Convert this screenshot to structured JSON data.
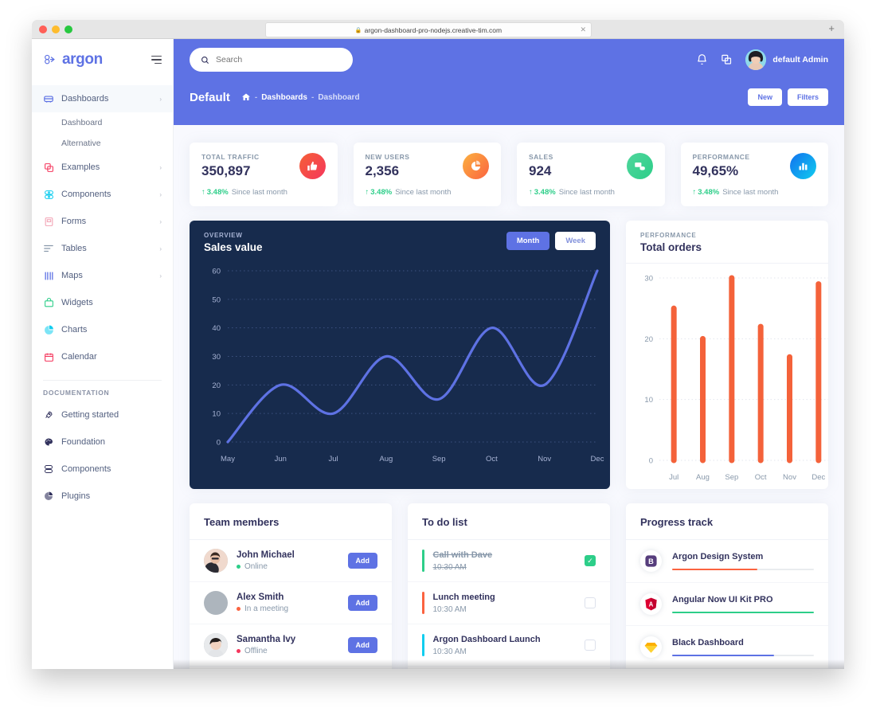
{
  "browser": {
    "url": "argon-dashboard-pro-nodejs.creative-tim.com",
    "lock_icon": "lock-icon",
    "close_tab_icon": "close-icon",
    "new_tab_icon": "plus-icon"
  },
  "sidebar": {
    "brand": "argon",
    "brand_color": "#5e72e4",
    "toggle_icon": "hamburger-icon",
    "items": [
      {
        "label": "Dashboards",
        "icon": "dashboard-icon",
        "color": "#5e72e4",
        "active": true,
        "chevron": "›"
      },
      {
        "label": "Examples",
        "icon": "examples-icon",
        "color": "#f5365c",
        "active": false,
        "chevron": "›"
      },
      {
        "label": "Components",
        "icon": "components-icon",
        "color": "#11cdef",
        "active": false,
        "chevron": "›"
      },
      {
        "label": "Forms",
        "icon": "forms-icon",
        "color": "#f3a4b5",
        "active": false,
        "chevron": "›"
      },
      {
        "label": "Tables",
        "icon": "tables-icon",
        "color": "#8898aa",
        "active": false,
        "chevron": "›"
      },
      {
        "label": "Maps",
        "icon": "maps-icon",
        "color": "#5e72e4",
        "active": false,
        "chevron": "›"
      },
      {
        "label": "Widgets",
        "icon": "widgets-icon",
        "color": "#2dce89",
        "active": false,
        "chevron": ""
      },
      {
        "label": "Charts",
        "icon": "charts-icon",
        "color": "#11cdef",
        "active": false,
        "chevron": ""
      },
      {
        "label": "Calendar",
        "icon": "calendar-icon",
        "color": "#f5365c",
        "active": false,
        "chevron": ""
      }
    ],
    "sub_items": [
      {
        "label": "Dashboard"
      },
      {
        "label": "Alternative"
      }
    ],
    "doc_section": "DOCUMENTATION",
    "doc_items": [
      {
        "label": "Getting started",
        "icon": "rocket-icon",
        "color": "#32325d"
      },
      {
        "label": "Foundation",
        "icon": "palette-icon",
        "color": "#32325d"
      },
      {
        "label": "Components",
        "icon": "components-icon",
        "color": "#32325d"
      },
      {
        "label": "Plugins",
        "icon": "pie-icon",
        "color": "#32325d"
      }
    ]
  },
  "topbar": {
    "bg_color": "#5e72e4",
    "search": {
      "placeholder": "Search",
      "value": "",
      "icon": "search-icon"
    },
    "bell_icon": "bell-icon",
    "apps_icon": "layers-icon",
    "avatar": "user-avatar",
    "user_name": "default Admin"
  },
  "header": {
    "title": "Default",
    "home_icon": "home-icon",
    "breadcrumb": [
      {
        "label": "Dashboards",
        "current": false
      },
      {
        "label": "Dashboard",
        "current": true
      }
    ],
    "separator": "-",
    "buttons": [
      {
        "label": "New"
      },
      {
        "label": "Filters"
      }
    ]
  },
  "stats": [
    {
      "label": "TOTAL TRAFFIC",
      "value": "350,897",
      "delta": "3.48%",
      "delta_arrow": "↑",
      "delta_color": "#2dce89",
      "caption": "Since last month",
      "icon": "thumbs-up-icon",
      "icon_bg": "#f5365c"
    },
    {
      "label": "NEW USERS",
      "value": "2,356",
      "delta": "3.48%",
      "delta_arrow": "↑",
      "delta_color": "#2dce89",
      "caption": "Since last month",
      "icon": "pie-chart-icon",
      "icon_bg": "#fb6340"
    },
    {
      "label": "SALES",
      "value": "924",
      "delta": "3.48%",
      "delta_arrow": "↑",
      "delta_color": "#2dce89",
      "caption": "Since last month",
      "icon": "money-icon",
      "icon_bg": "#2dce89"
    },
    {
      "label": "PERFORMANCE",
      "value": "49,65%",
      "delta": "3.48%",
      "delta_arrow": "↑",
      "delta_color": "#2dce89",
      "caption": "Since last month",
      "icon": "bar-chart-icon",
      "icon_bg": "#11cdef"
    }
  ],
  "chart_data": [
    {
      "type": "line",
      "eyebrow": "OVERVIEW",
      "title": "Sales value",
      "categories": [
        "May",
        "Jun",
        "Jul",
        "Aug",
        "Sep",
        "Oct",
        "Nov",
        "Dec"
      ],
      "values": [
        0,
        20,
        10,
        30,
        15,
        40,
        20,
        60
      ],
      "xlabel": "",
      "ylabel": "",
      "ylim": [
        0,
        60
      ],
      "yticks": [
        0,
        10,
        20,
        30,
        40,
        50,
        60
      ],
      "grid": true,
      "legend": "none",
      "line_color": "#5e72e4",
      "bg_color": "#172b4d",
      "toggle": [
        {
          "label": "Month",
          "active": true
        },
        {
          "label": "Week",
          "active": false
        }
      ]
    },
    {
      "type": "bar",
      "eyebrow": "PERFORMANCE",
      "title": "Total orders",
      "categories": [
        "Jul",
        "Aug",
        "Sep",
        "Oct",
        "Nov",
        "Dec"
      ],
      "values": [
        25,
        20,
        30,
        22,
        17,
        29
      ],
      "xlabel": "",
      "ylabel": "",
      "ylim": [
        0,
        30
      ],
      "yticks": [
        0,
        10,
        20,
        30
      ],
      "grid": true,
      "legend": "none",
      "bar_color": "#f4623a"
    }
  ],
  "team": {
    "title": "Team members",
    "members": [
      {
        "name": "John Michael",
        "status": "Online",
        "status_color": "#2dce89",
        "action": "Add",
        "avatar": "avatar-john"
      },
      {
        "name": "Alex Smith",
        "status": "In a meeting",
        "status_color": "#fb6340",
        "action": "Add",
        "avatar": "avatar-alex"
      },
      {
        "name": "Samantha Ivy",
        "status": "Offline",
        "status_color": "#f5365c",
        "action": "Add",
        "avatar": "avatar-samantha"
      }
    ]
  },
  "todo": {
    "title": "To do list",
    "items": [
      {
        "title": "Call with Dave",
        "time": "10:30 AM",
        "bar_color": "#2dce89",
        "done": true
      },
      {
        "title": "Lunch meeting",
        "time": "10:30 AM",
        "bar_color": "#fb6340",
        "done": false
      },
      {
        "title": "Argon Dashboard Launch",
        "time": "10:30 AM",
        "bar_color": "#11cdef",
        "done": false
      }
    ]
  },
  "progress": {
    "title": "Progress track",
    "items": [
      {
        "name": "Argon Design System",
        "percent": 60,
        "bar_color": "#fb6340",
        "logo": "bootstrap-icon",
        "logo_color": "#563d7c",
        "logo_text": "B"
      },
      {
        "name": "Angular Now UI Kit PRO",
        "percent": 100,
        "bar_color": "#2dce89",
        "logo": "angular-icon",
        "logo_color": "#dd0031",
        "logo_text": "A"
      },
      {
        "name": "Black Dashboard",
        "percent": 72,
        "bar_color": "#5e72e4",
        "logo": "sketch-icon",
        "logo_color": "#fdad00",
        "logo_text": "◇"
      }
    ]
  }
}
